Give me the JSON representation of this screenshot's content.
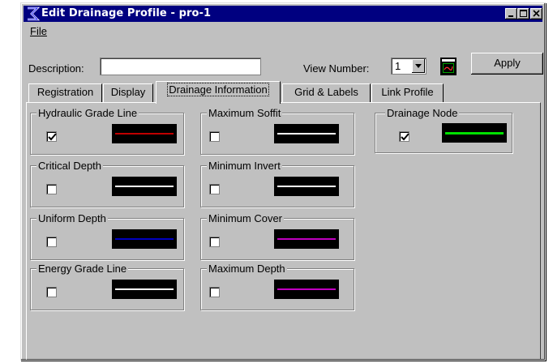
{
  "window": {
    "title": "Edit Drainage Profile - pro-1"
  },
  "menu": {
    "file": "File"
  },
  "form": {
    "description_label": "Description:",
    "description_value": "",
    "view_number_label": "View Number:",
    "view_number_value": "1",
    "apply_label": "Apply"
  },
  "tabs": [
    {
      "label": "Registration",
      "selected": false
    },
    {
      "label": "Display",
      "selected": false
    },
    {
      "label": "Drainage Information",
      "selected": true
    },
    {
      "label": "Grid & Labels",
      "selected": false
    },
    {
      "label": "Link Profile",
      "selected": false
    }
  ],
  "groups": [
    {
      "label": "Hydraulic Grade Line",
      "checked": true,
      "line_color": "#c00000"
    },
    {
      "label": "Critical Depth",
      "checked": false,
      "line_color": "#ffffff"
    },
    {
      "label": "Uniform Depth",
      "checked": false,
      "line_color": "#0000c0"
    },
    {
      "label": "Energy Grade Line",
      "checked": false,
      "line_color": "#ffffff"
    },
    {
      "label": "Maximum Soffit",
      "checked": false,
      "line_color": "#ffffff"
    },
    {
      "label": "Minimum Invert",
      "checked": false,
      "line_color": "#ffffff"
    },
    {
      "label": "Minimum Cover",
      "checked": false,
      "line_color": "#c000c0"
    },
    {
      "label": "Maximum Depth",
      "checked": false,
      "line_color": "#c000c0"
    },
    {
      "label": "Drainage Node",
      "checked": true,
      "line_color": "#00e000"
    }
  ],
  "colors": {
    "titlebar": "#000080",
    "face": "#c0c0c0"
  },
  "icons": {
    "app": "drainage-app-icon",
    "view": "view-window-icon"
  }
}
